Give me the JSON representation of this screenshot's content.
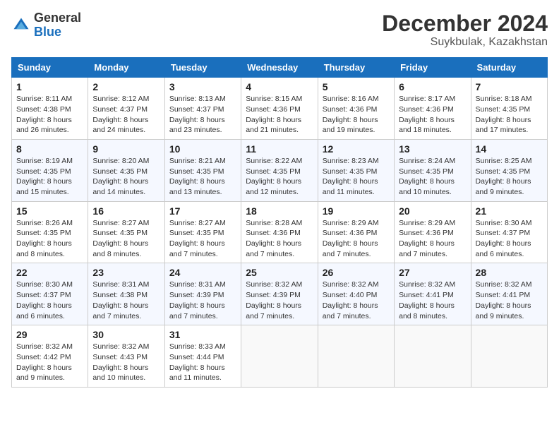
{
  "header": {
    "logo_general": "General",
    "logo_blue": "Blue",
    "month_title": "December 2024",
    "location": "Suykbulak, Kazakhstan"
  },
  "days_of_week": [
    "Sunday",
    "Monday",
    "Tuesday",
    "Wednesday",
    "Thursday",
    "Friday",
    "Saturday"
  ],
  "weeks": [
    [
      {
        "day": 1,
        "sunrise": "8:11 AM",
        "sunset": "4:38 PM",
        "daylight": "8 hours and 26 minutes."
      },
      {
        "day": 2,
        "sunrise": "8:12 AM",
        "sunset": "4:37 PM",
        "daylight": "8 hours and 24 minutes."
      },
      {
        "day": 3,
        "sunrise": "8:13 AM",
        "sunset": "4:37 PM",
        "daylight": "8 hours and 23 minutes."
      },
      {
        "day": 4,
        "sunrise": "8:15 AM",
        "sunset": "4:36 PM",
        "daylight": "8 hours and 21 minutes."
      },
      {
        "day": 5,
        "sunrise": "8:16 AM",
        "sunset": "4:36 PM",
        "daylight": "8 hours and 19 minutes."
      },
      {
        "day": 6,
        "sunrise": "8:17 AM",
        "sunset": "4:36 PM",
        "daylight": "8 hours and 18 minutes."
      },
      {
        "day": 7,
        "sunrise": "8:18 AM",
        "sunset": "4:35 PM",
        "daylight": "8 hours and 17 minutes."
      }
    ],
    [
      {
        "day": 8,
        "sunrise": "8:19 AM",
        "sunset": "4:35 PM",
        "daylight": "8 hours and 15 minutes."
      },
      {
        "day": 9,
        "sunrise": "8:20 AM",
        "sunset": "4:35 PM",
        "daylight": "8 hours and 14 minutes."
      },
      {
        "day": 10,
        "sunrise": "8:21 AM",
        "sunset": "4:35 PM",
        "daylight": "8 hours and 13 minutes."
      },
      {
        "day": 11,
        "sunrise": "8:22 AM",
        "sunset": "4:35 PM",
        "daylight": "8 hours and 12 minutes."
      },
      {
        "day": 12,
        "sunrise": "8:23 AM",
        "sunset": "4:35 PM",
        "daylight": "8 hours and 11 minutes."
      },
      {
        "day": 13,
        "sunrise": "8:24 AM",
        "sunset": "4:35 PM",
        "daylight": "8 hours and 10 minutes."
      },
      {
        "day": 14,
        "sunrise": "8:25 AM",
        "sunset": "4:35 PM",
        "daylight": "8 hours and 9 minutes."
      }
    ],
    [
      {
        "day": 15,
        "sunrise": "8:26 AM",
        "sunset": "4:35 PM",
        "daylight": "8 hours and 8 minutes."
      },
      {
        "day": 16,
        "sunrise": "8:27 AM",
        "sunset": "4:35 PM",
        "daylight": "8 hours and 8 minutes."
      },
      {
        "day": 17,
        "sunrise": "8:27 AM",
        "sunset": "4:35 PM",
        "daylight": "8 hours and 7 minutes."
      },
      {
        "day": 18,
        "sunrise": "8:28 AM",
        "sunset": "4:36 PM",
        "daylight": "8 hours and 7 minutes."
      },
      {
        "day": 19,
        "sunrise": "8:29 AM",
        "sunset": "4:36 PM",
        "daylight": "8 hours and 7 minutes."
      },
      {
        "day": 20,
        "sunrise": "8:29 AM",
        "sunset": "4:36 PM",
        "daylight": "8 hours and 7 minutes."
      },
      {
        "day": 21,
        "sunrise": "8:30 AM",
        "sunset": "4:37 PM",
        "daylight": "8 hours and 6 minutes."
      }
    ],
    [
      {
        "day": 22,
        "sunrise": "8:30 AM",
        "sunset": "4:37 PM",
        "daylight": "8 hours and 6 minutes."
      },
      {
        "day": 23,
        "sunrise": "8:31 AM",
        "sunset": "4:38 PM",
        "daylight": "8 hours and 7 minutes."
      },
      {
        "day": 24,
        "sunrise": "8:31 AM",
        "sunset": "4:39 PM",
        "daylight": "8 hours and 7 minutes."
      },
      {
        "day": 25,
        "sunrise": "8:32 AM",
        "sunset": "4:39 PM",
        "daylight": "8 hours and 7 minutes."
      },
      {
        "day": 26,
        "sunrise": "8:32 AM",
        "sunset": "4:40 PM",
        "daylight": "8 hours and 7 minutes."
      },
      {
        "day": 27,
        "sunrise": "8:32 AM",
        "sunset": "4:41 PM",
        "daylight": "8 hours and 8 minutes."
      },
      {
        "day": 28,
        "sunrise": "8:32 AM",
        "sunset": "4:41 PM",
        "daylight": "8 hours and 9 minutes."
      }
    ],
    [
      {
        "day": 29,
        "sunrise": "8:32 AM",
        "sunset": "4:42 PM",
        "daylight": "8 hours and 9 minutes."
      },
      {
        "day": 30,
        "sunrise": "8:32 AM",
        "sunset": "4:43 PM",
        "daylight": "8 hours and 10 minutes."
      },
      {
        "day": 31,
        "sunrise": "8:33 AM",
        "sunset": "4:44 PM",
        "daylight": "8 hours and 11 minutes."
      },
      null,
      null,
      null,
      null
    ]
  ]
}
